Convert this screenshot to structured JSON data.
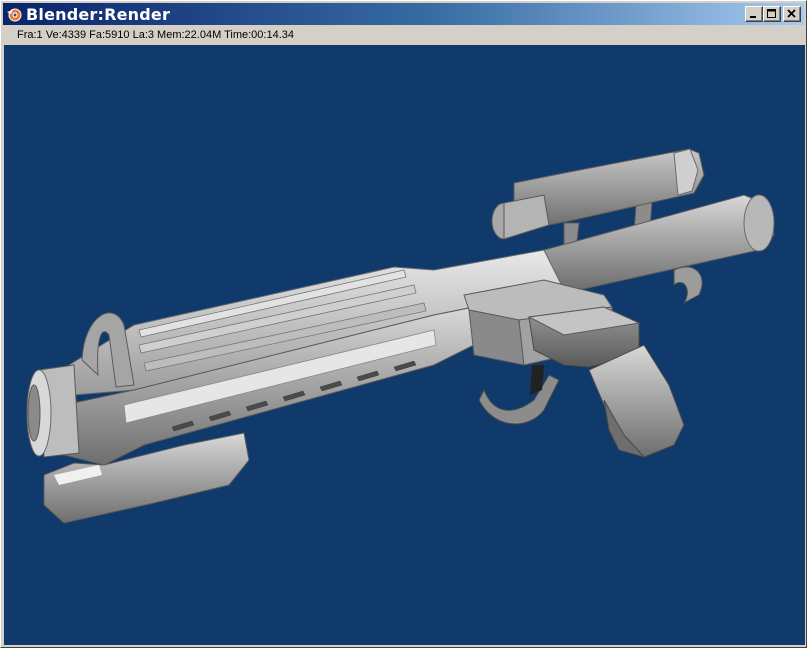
{
  "window": {
    "title": "Blender:Render",
    "app_icon": "blender-icon",
    "controls": {
      "minimize_icon": "minimize-icon",
      "maximize_icon": "maximize-icon",
      "close_icon": "close-icon"
    }
  },
  "status": {
    "text": "Fra:1  Ve:4339 Fa:5910 La:3 Mem:22.04M Time:00:14.34"
  },
  "render": {
    "subject": "3d-rendered-blaster-rifle",
    "background_color": "#0f3a6b",
    "model_color": "#9a9a9a"
  }
}
